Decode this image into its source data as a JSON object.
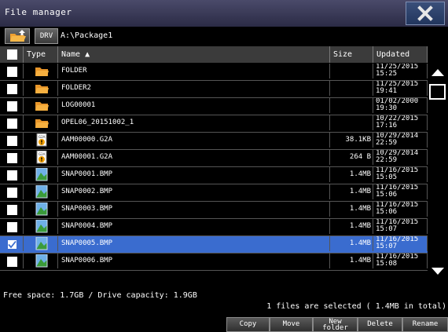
{
  "window": {
    "title": "File manager"
  },
  "path": {
    "drive_label": "DRV",
    "current_path": "A:\\Package1"
  },
  "columns": {
    "type": "Type",
    "name": "Name ▲",
    "size": "Size",
    "updated": "Updated"
  },
  "rows": [
    {
      "name": "FOLDER",
      "size": "",
      "date": "11/25/2015",
      "time": "15:25",
      "icon": "folder-icon",
      "checked": false
    },
    {
      "name": "FOLDER2",
      "size": "",
      "date": "11/25/2015",
      "time": "19:41",
      "icon": "folder-icon",
      "checked": false
    },
    {
      "name": "LOG00001",
      "size": "",
      "date": "01/02/2000",
      "time": "19:30",
      "icon": "folder-icon",
      "checked": false
    },
    {
      "name": "OPEL06_20151002_1",
      "size": "",
      "date": "10/22/2015",
      "time": "17:16",
      "icon": "folder-icon",
      "checked": false
    },
    {
      "name": "AAM00000.G2A",
      "size": "38.1KB",
      "date": "10/29/2014",
      "time": "22:59",
      "icon": "g2a-file-icon",
      "checked": false
    },
    {
      "name": "AAM00001.G2A",
      "size": "264 B",
      "date": "10/29/2014",
      "time": "22:59",
      "icon": "g2a-file-icon",
      "checked": false
    },
    {
      "name": "SNAP0001.BMP",
      "size": "1.4MB",
      "date": "11/16/2015",
      "time": "15:05",
      "icon": "bmp-file-icon",
      "checked": false
    },
    {
      "name": "SNAP0002.BMP",
      "size": "1.4MB",
      "date": "11/16/2015",
      "time": "15:06",
      "icon": "bmp-file-icon",
      "checked": false
    },
    {
      "name": "SNAP0003.BMP",
      "size": "1.4MB",
      "date": "11/16/2015",
      "time": "15:06",
      "icon": "bmp-file-icon",
      "checked": false
    },
    {
      "name": "SNAP0004.BMP",
      "size": "1.4MB",
      "date": "11/16/2015",
      "time": "15:07",
      "icon": "bmp-file-icon",
      "checked": false
    },
    {
      "name": "SNAP0005.BMP",
      "size": "1.4MB",
      "date": "11/16/2015",
      "time": "15:07",
      "icon": "bmp-file-icon",
      "checked": true
    },
    {
      "name": "SNAP0006.BMP",
      "size": "1.4MB",
      "date": "11/16/2015",
      "time": "15:08",
      "icon": "bmp-file-icon",
      "checked": false
    }
  ],
  "status": {
    "free_space": "Free space:  1.7GB / Drive capacity:  1.9GB",
    "selection": "1 files are selected ( 1.4MB in total)"
  },
  "buttons": {
    "copy": "Copy",
    "move": "Move",
    "new_folder_line1": "New",
    "new_folder_line2": "folder",
    "delete": "Delete",
    "rename": "Rename"
  },
  "colors": {
    "selection": "#3a6ccf",
    "title_bar": "#3b3b5a",
    "folder": "#f0a030"
  }
}
